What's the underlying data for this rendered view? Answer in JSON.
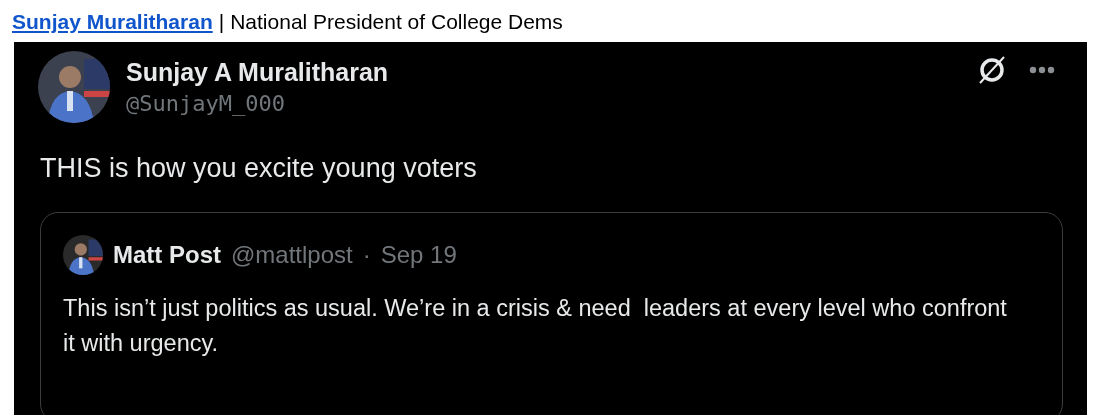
{
  "header": {
    "link": "Sunjay Muralitharan",
    "separator": "|",
    "title": "National President of College Dems"
  },
  "tweet": {
    "author": {
      "name": "Sunjay A Muralitharan",
      "handle": "@SunjayM_000"
    },
    "text": "THIS is how you excite young voters",
    "quote": {
      "name": "Matt Post",
      "handle": "@mattlpost",
      "separator": "·",
      "date": "Sep 19",
      "text": "This isn’t just politics as usual. We’re in a crisis & need  leaders at every level who confront it with urgency."
    }
  }
}
